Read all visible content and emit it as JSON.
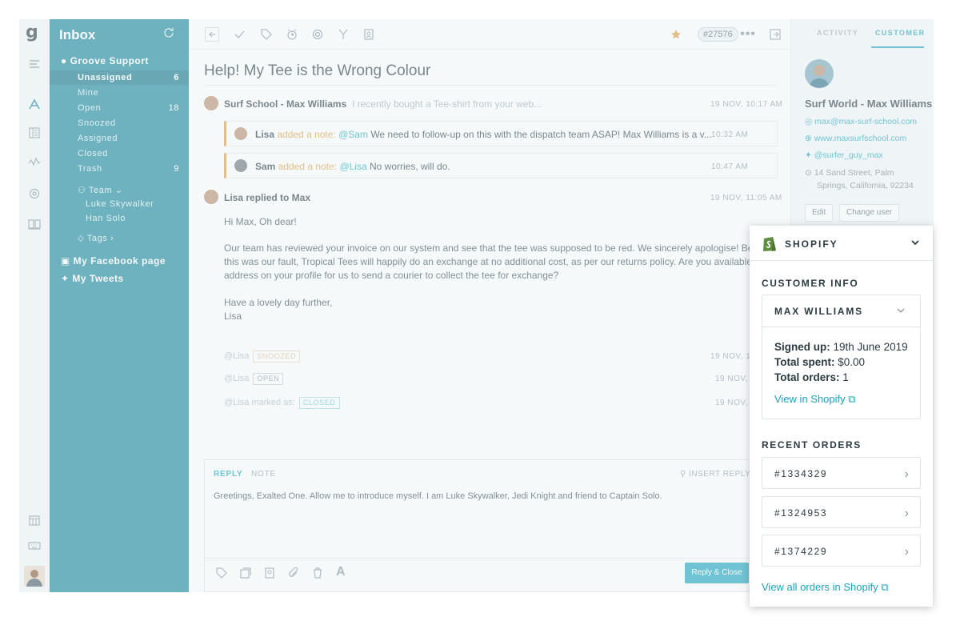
{
  "sidebar": {
    "title": "Inbox",
    "mailbox": "Groove Support",
    "folders": [
      {
        "label": "Unassigned",
        "count": "6"
      },
      {
        "label": "Mine",
        "count": ""
      },
      {
        "label": "Open",
        "count": "18"
      },
      {
        "label": "Snoozed",
        "count": ""
      },
      {
        "label": "Assigned",
        "count": ""
      },
      {
        "label": "Closed",
        "count": ""
      },
      {
        "label": "Trash",
        "count": "9"
      }
    ],
    "team_label": "Team",
    "team_members": [
      "Luke Skywalker",
      "Han Solo"
    ],
    "tags_label": "Tags",
    "facebook": "My Facebook page",
    "tweets": "My Tweets"
  },
  "toolbar": {
    "ticket_id": "#27576"
  },
  "conversation": {
    "subject": "Help! My Tee is the Wrong Colour",
    "first": {
      "sender": "Surf School - Max Williams",
      "preview": "I recently bought a Tee-shirt from your web...",
      "time": "19 NOV, 10:17 AM"
    },
    "notes": [
      {
        "author": "Lisa",
        "action": "added a note:",
        "mention": "@Sam",
        "text": "We need to follow-up on this with the dispatch team ASAP! Max Williams is a v...",
        "time": "10:32 AM"
      },
      {
        "author": "Sam",
        "action": "added a note:",
        "mention": "@Lisa",
        "text": "No worries, will do.",
        "time": "10:47 AM"
      }
    ],
    "reply": {
      "header": "Lisa replied to Max",
      "time": "19 NOV, 11:05 AM",
      "greeting": "Hi Max, Oh dear!",
      "line1": "Our team has reviewed your invoice on our system and see that the tee was supposed to be red. We sincerely apologise! Beca",
      "line2": "this was our fault, Tropical Tees will happily do an exchange at no additional cost, as per our returns policy. Are you available",
      "line3": "address on your profile for us to send a courier to collect the tee for exchange?",
      "sign1": "Have a lovely day further,",
      "sign2": "Lisa"
    },
    "history": [
      {
        "who": "@Lisa",
        "tag": "SNOOZED",
        "time": "19 NOV, 1"
      },
      {
        "who": "@Lisa",
        "tag": "OPEN",
        "time": "19 NOV,"
      },
      {
        "who": "@Lisa marked as:",
        "tag": "CLOSED",
        "time": "19 NOV,"
      }
    ]
  },
  "composer": {
    "tab_reply": "REPLY",
    "tab_note": "NOTE",
    "insert_reply": "INSERT REPLY",
    "text": "Greetings, Exalted One. Allow me to introduce myself. I am Luke Skywalker, Jedi Knight and friend to Captain Solo.",
    "send": "Reply & Close"
  },
  "customer_panel": {
    "tab_activity": "ACTIVITY",
    "tab_customer": "CUSTOMER",
    "name": "Surf World - Max Williams",
    "email": "max@max-surf-school.com",
    "website": "www.maxsurfschool.com",
    "twitter": "@surfer_guy_max",
    "address1": "14 Sand Street, Palm",
    "address2": "Springs, California, 92234",
    "edit": "Edit",
    "change_user": "Change user"
  },
  "shopify": {
    "title": "SHOPIFY",
    "customer_info": "CUSTOMER INFO",
    "customer_name": "MAX WILLIAMS",
    "signed_up_label": "Signed up:",
    "signed_up": "19th June 2019",
    "total_spent_label": "Total spent:",
    "total_spent": "$0.00",
    "total_orders_label": "Total orders:",
    "total_orders": "1",
    "view_link": "View in Shopify",
    "recent_orders": "RECENT ORDERS",
    "orders": [
      "#1334329",
      "#1324953",
      "#1374229"
    ],
    "view_all": "View all orders in Shopify"
  },
  "colors": {
    "teal": "#17869a",
    "accent": "#1ba3bd",
    "note": "#e09a3b",
    "shopify_green": "#5e8e3e"
  }
}
